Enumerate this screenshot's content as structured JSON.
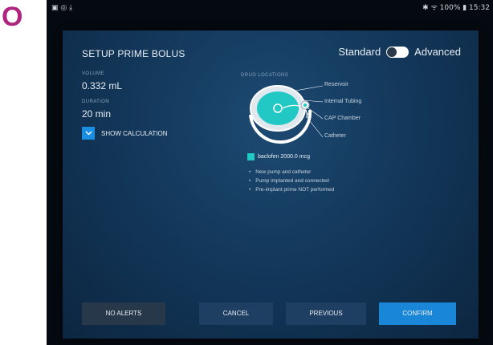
{
  "corner_label": "O",
  "statusbar": {
    "left_icons": "▣ ◎ ⤓",
    "right_text": "✱ ᯤ 100% ▮ 15:32"
  },
  "dialog": {
    "title": "SETUP PRIME BOLUS",
    "mode": {
      "standard_label": "Standard",
      "advanced_label": "Advanced",
      "selected": "Advanced"
    },
    "volume": {
      "label": "VOLUME",
      "value": "0.332 mL"
    },
    "duration": {
      "label": "DURATION",
      "value": "20 min"
    },
    "show_calculation_label": "SHOW CALCULATION",
    "drug_locations": {
      "label": "DRUG LOCATIONS",
      "callouts": {
        "reservoir": "Reservoir",
        "internal_tubing": "Internal Tubing",
        "cap_chamber": "CAP Chamber",
        "catheter": "Catheter"
      }
    },
    "drug": {
      "text": "baclofen 2000.0 mcg",
      "color": "#22c8c4"
    },
    "notes": [
      "New pump and catheter",
      "Pump implanted and connected",
      "Pre-implant prime NOT performed"
    ],
    "buttons": {
      "no_alerts": "NO ALERTS",
      "cancel": "CANCEL",
      "previous": "PREVIOUS",
      "confirm": "CONFIRM"
    }
  },
  "colors": {
    "accent": "#1a86d8",
    "drug": "#22c8c4",
    "corner_label": "#b0237e"
  }
}
